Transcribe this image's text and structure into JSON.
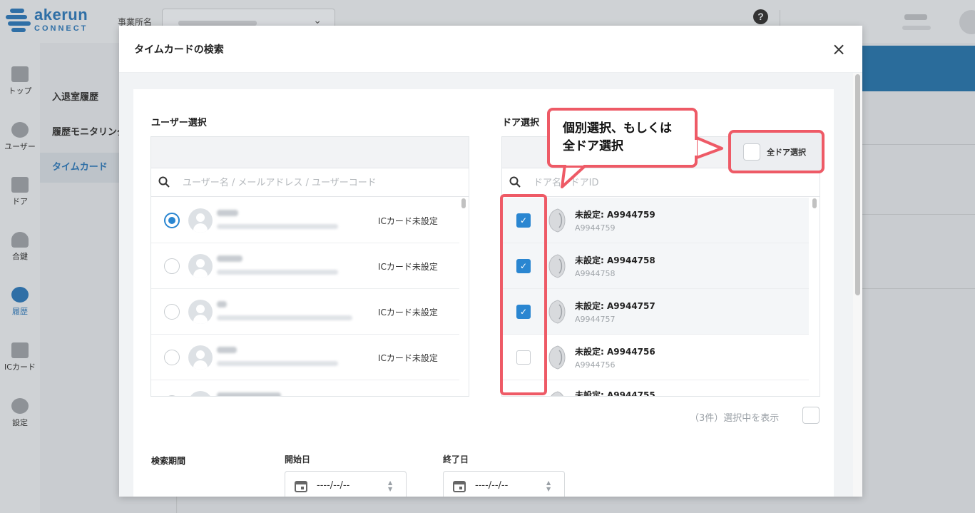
{
  "app": {
    "logo_text": "akerun",
    "logo_sub": "CONNECT",
    "office_label": "事業所名",
    "help_symbol": "?"
  },
  "sidenav": [
    {
      "label": "トップ",
      "icon": "dashboard-icon"
    },
    {
      "label": "ユーザー",
      "icon": "users-icon"
    },
    {
      "label": "ドア",
      "icon": "door-icon"
    },
    {
      "label": "合鍵",
      "icon": "key-icon"
    },
    {
      "label": "履歴",
      "icon": "history-icon",
      "active": true
    },
    {
      "label": "ICカード",
      "icon": "card-icon"
    },
    {
      "label": "設定",
      "icon": "gear-icon"
    }
  ],
  "subnav": [
    {
      "label": "入退室履歴"
    },
    {
      "label": "履歴モニタリング"
    },
    {
      "label": "タイムカード",
      "active": true
    }
  ],
  "modal": {
    "title": "タイムカードの検索",
    "close_symbol": "×"
  },
  "user_select": {
    "label": "ユーザー選択",
    "search_placeholder": "ユーザー名 / メールアドレス / ユーザーコード",
    "rows": [
      {
        "selected": true,
        "status": "ICカード未設定"
      },
      {
        "selected": false,
        "status": "ICカード未設定"
      },
      {
        "selected": false,
        "status": "ICカード未設定"
      },
      {
        "selected": false,
        "status": "ICカード未設定"
      }
    ]
  },
  "door_select": {
    "label": "ドア選択",
    "search_placeholder": "ドア名 / ドアID",
    "all_label": "全ドア選択",
    "rows": [
      {
        "name": "未設定: A9944759",
        "id": "A9944759",
        "checked": true
      },
      {
        "name": "未設定: A9944758",
        "id": "A9944758",
        "checked": true
      },
      {
        "name": "未設定: A9944757",
        "id": "A9944757",
        "checked": true
      },
      {
        "name": "未設定: A9944756",
        "id": "A9944756",
        "checked": false
      },
      {
        "name": "未設定: A9944755",
        "id": "",
        "checked": false
      }
    ],
    "show_selected": "（3件）選択中を表示"
  },
  "period": {
    "label": "検索期間",
    "start_label": "開始日",
    "end_label": "終了日",
    "start_value": "----/--/--",
    "end_value": "----/--/--"
  },
  "annotation": {
    "callout": "個別選択、もしくは\n全ドア選択",
    "color": "#ee5a66"
  },
  "colors": {
    "accent": "#2a86d1",
    "brand": "#2f6fa6"
  }
}
